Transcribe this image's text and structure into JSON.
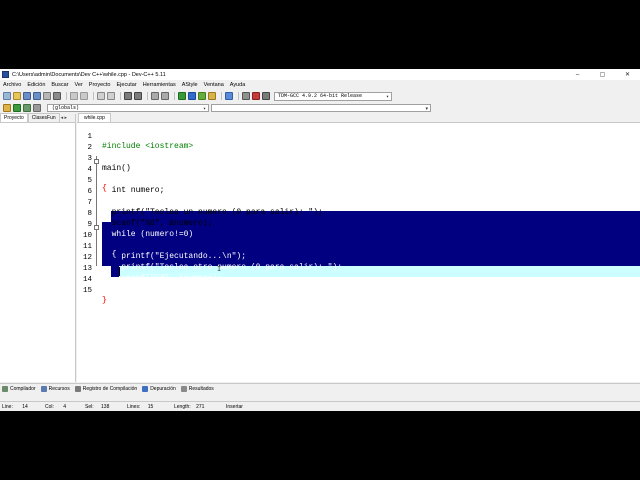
{
  "window": {
    "title": "C:\\Users\\admin\\Documents\\Dev C++\\while.cpp - Dev-C++ 5.11",
    "controls": {
      "minimize": "–",
      "maximize": "▢",
      "close": "✕"
    }
  },
  "menu": [
    "Archivo",
    "Edición",
    "Buscar",
    "Ver",
    "Proyecto",
    "Ejecutar",
    "Herramientas",
    "AStyle",
    "Ventana",
    "Ayuda"
  ],
  "toolbar": {
    "compiler": "TDM-GCC 4.9.2 64-bit Release",
    "scope": "(globals)"
  },
  "left_panel": {
    "tabs": [
      "Proyecto",
      "Clases",
      "Fun"
    ],
    "scroll_arrows": "◂ ▸"
  },
  "editor": {
    "tab": "while.cpp",
    "cursor_glyph": "I",
    "lines": [
      {
        "num": "1",
        "text": "#include <iostream>"
      },
      {
        "num": "2",
        "text": ""
      },
      {
        "num": "3",
        "text": "main()"
      },
      {
        "num": "4",
        "text": "{",
        "fold": "−"
      },
      {
        "num": "5",
        "text": "  int numero;"
      },
      {
        "num": "6",
        "text": ""
      },
      {
        "num": "7",
        "text": "  printf(\"Teclea un numero (0 para salir): \");"
      },
      {
        "num": "8",
        "text": "  scanf(\"%d\", &numero);"
      },
      {
        "num": "9",
        "text": "  while (numero!=0)"
      },
      {
        "num": "10",
        "text": "  {",
        "fold": "−"
      },
      {
        "num": "11",
        "text": "    printf(\"Ejecutando...\\n\");"
      },
      {
        "num": "12",
        "text": "    printf(\"Teclea otro numero (0 para salir): \");"
      },
      {
        "num": "13",
        "text": "    scanf(\"%d\", &numero);"
      },
      {
        "num": "14",
        "text": "  }"
      },
      {
        "num": "15",
        "text": "}"
      }
    ]
  },
  "bottom_tabs": [
    "Compilador",
    "Recursos",
    "Registro de Compilación",
    "Depuración",
    "Resultados"
  ],
  "status": {
    "line_label": "Line:",
    "line_value": "14",
    "col_label": "Col:",
    "col_value": "4",
    "sel_label": "Sel:",
    "sel_value": "138",
    "lines_label": "Lines:",
    "lines_value": "15",
    "length_label": "Length:",
    "length_value": "271",
    "mode": "Insertar"
  },
  "colors": {
    "selection": "#000080",
    "preprocessor": "#008000",
    "string": "#0000ff",
    "symbol": "#ff0000",
    "current_line": "#ccffff"
  }
}
